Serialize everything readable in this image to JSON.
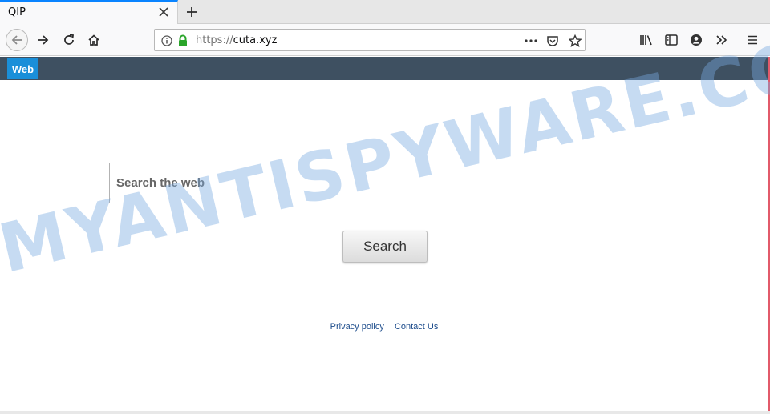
{
  "browser": {
    "tab": {
      "title": "QIP"
    },
    "url": {
      "scheme": "https://",
      "host": "cuta.xyz"
    }
  },
  "site": {
    "nav": {
      "web_label": "Web"
    },
    "search": {
      "placeholder": "Search the web",
      "button_label": "Search"
    },
    "footer": {
      "privacy_label": "Privacy policy",
      "contact_label": "Contact Us"
    }
  },
  "watermark": {
    "text": "MYANTISPYWARE.COM"
  },
  "colors": {
    "site_bar": "#3e5061",
    "web_tab": "#1a8fd9",
    "secure_lock": "#2aa52a",
    "link": "#1a4a8a"
  }
}
